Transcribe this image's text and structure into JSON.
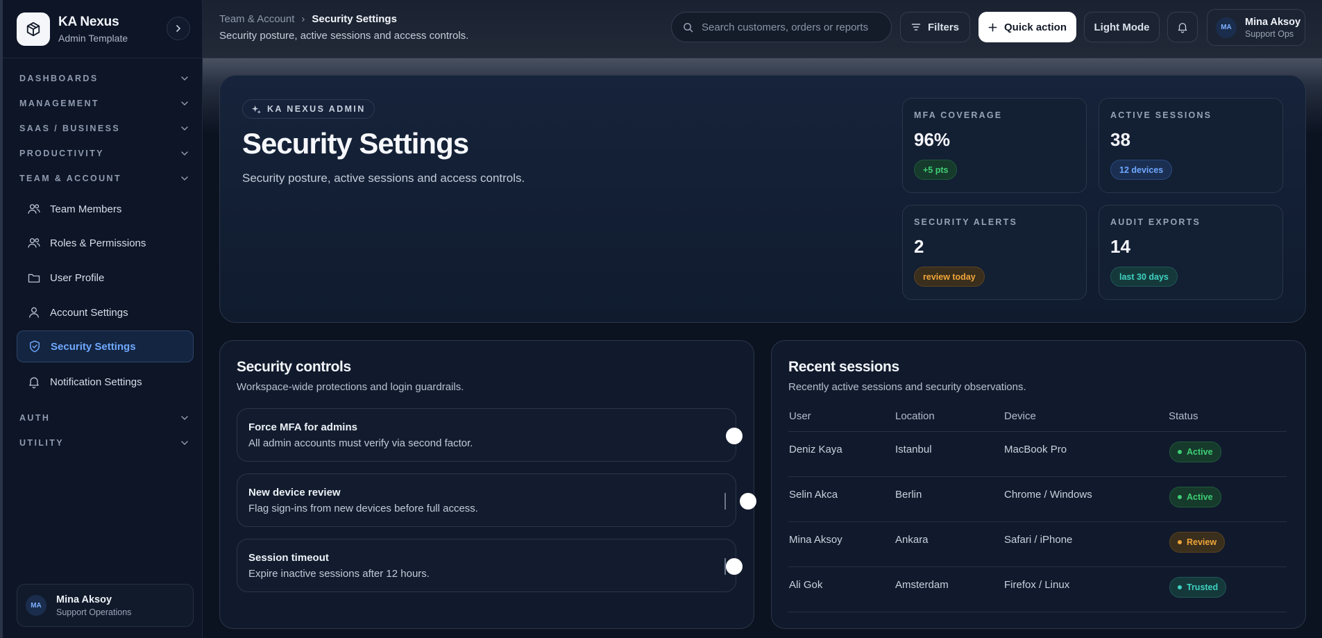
{
  "brand": {
    "name": "KA Nexus",
    "subtitle": "Admin Template"
  },
  "sidebar": {
    "groups": [
      {
        "label": "DASHBOARDS"
      },
      {
        "label": "MANAGEMENT"
      },
      {
        "label": "SAAS / BUSINESS"
      },
      {
        "label": "PRODUCTIVITY"
      },
      {
        "label": "TEAM & ACCOUNT"
      },
      {
        "label": "AUTH"
      },
      {
        "label": "UTILITY"
      }
    ],
    "items": [
      {
        "label": "Team Members",
        "icon": "users-icon"
      },
      {
        "label": "Roles & Permissions",
        "icon": "users-icon"
      },
      {
        "label": "User Profile",
        "icon": "folder-icon"
      },
      {
        "label": "Account Settings",
        "icon": "user-icon"
      },
      {
        "label": "Security Settings",
        "icon": "shield-icon",
        "active": true
      },
      {
        "label": "Notification Settings",
        "icon": "bell-icon"
      }
    ],
    "user": {
      "initials": "MA",
      "name": "Mina Aksoy",
      "role": "Support Operations"
    }
  },
  "topbar": {
    "breadcrumb": {
      "parent": "Team & Account",
      "separator": "›",
      "current": "Security Settings"
    },
    "subtitle": "Security posture, active sessions and access controls.",
    "search_placeholder": "Search customers, orders or reports",
    "filters_label": "Filters",
    "quick_action_label": "Quick action",
    "theme_label": "Light Mode",
    "profile": {
      "initials": "MA",
      "name": "Mina Aksoy",
      "role": "Support Ops"
    }
  },
  "hero": {
    "eyebrow": "KA NEXUS ADMIN",
    "title": "Security Settings",
    "subtitle": "Security posture, active sessions and access controls.",
    "stats": [
      {
        "label": "MFA COVERAGE",
        "value": "96%",
        "badge": "+5 pts",
        "tone": "green"
      },
      {
        "label": "ACTIVE SESSIONS",
        "value": "38",
        "badge": "12 devices",
        "tone": "blue"
      },
      {
        "label": "SECURITY ALERTS",
        "value": "2",
        "badge": "review today",
        "tone": "amber"
      },
      {
        "label": "AUDIT EXPORTS",
        "value": "14",
        "badge": "last 30 days",
        "tone": "teal"
      }
    ]
  },
  "controls": {
    "title": "Security controls",
    "subtitle": "Workspace-wide protections and login guardrails.",
    "items": [
      {
        "title": "Force MFA for admins",
        "desc": "All admin accounts must verify via second factor."
      },
      {
        "title": "New device review",
        "desc": "Flag sign-ins from new devices before full access."
      },
      {
        "title": "Session timeout",
        "desc": "Expire inactive sessions after 12 hours."
      }
    ]
  },
  "sessions": {
    "title": "Recent sessions",
    "subtitle": "Recently active sessions and security observations.",
    "columns": [
      "User",
      "Location",
      "Device",
      "Status"
    ],
    "rows": [
      {
        "user": "Deniz Kaya",
        "location": "Istanbul",
        "device": "MacBook Pro",
        "status": "Active",
        "tone": "green"
      },
      {
        "user": "Selin Akca",
        "location": "Berlin",
        "device": "Chrome / Windows",
        "status": "Active",
        "tone": "green"
      },
      {
        "user": "Mina Aksoy",
        "location": "Ankara",
        "device": "Safari / iPhone",
        "status": "Review",
        "tone": "amber"
      },
      {
        "user": "Ali Gok",
        "location": "Amsterdam",
        "device": "Firefox / Linux",
        "status": "Trusted",
        "tone": "teal"
      }
    ]
  },
  "colors": {
    "accent_blue": "#6fa8ff",
    "green": "#3ecf75",
    "amber": "#f0a63a",
    "teal": "#3fd3c0"
  }
}
